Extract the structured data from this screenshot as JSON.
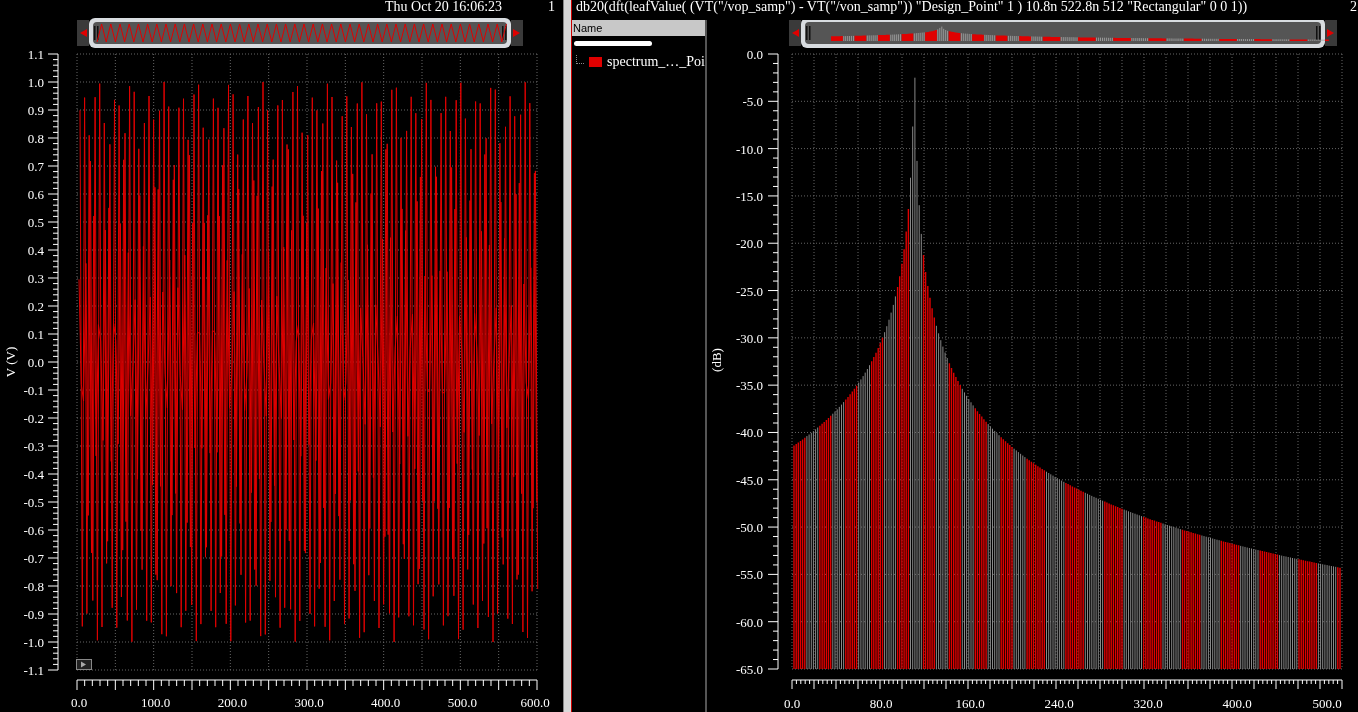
{
  "left_plot": {
    "timestamp": "Thu Oct 20 16:06:23",
    "corner_label": "1",
    "y_axis": {
      "label": "V (V)",
      "ticks": [
        "1.1",
        "1.0",
        "0.9",
        "0.8",
        "0.7",
        "0.6",
        "0.5",
        "0.4",
        "0.3",
        "0.2",
        "0.1",
        "0.0",
        "-0.1",
        "-0.2",
        "-0.3",
        "-0.4",
        "-0.5",
        "-0.6",
        "-0.7",
        "-0.8",
        "-0.9",
        "-1.0",
        "-1.1"
      ]
    },
    "x_axis": {
      "ticks": [
        "0.0",
        "100.0",
        "200.0",
        "300.0",
        "400.0",
        "500.0",
        "600.0"
      ]
    }
  },
  "right_section": {
    "title": "db20(dft(leafValue( (VT(\"/vop_samp\") - VT(\"/von_samp\")) \"Design_Point\" 1 )  10.8n 522.8n 512 \"Rectangular\" 0 0 1))",
    "legend": {
      "header": "Name",
      "items": [
        {
          "label": "spectrum_…_Poi"
        }
      ]
    },
    "plot": {
      "corner_label": "2",
      "y_axis": {
        "label": "(dB)",
        "ticks": [
          "0.0",
          "-5.0",
          "-10.0",
          "-15.0",
          "-20.0",
          "-25.0",
          "-30.0",
          "-35.0",
          "-40.0",
          "-45.0",
          "-50.0",
          "-55.0",
          "-60.0",
          "-65.0"
        ]
      },
      "x_axis": {
        "ticks": [
          "0.0",
          "80.0",
          "160.0",
          "240.0",
          "320.0",
          "400.0",
          "500.0"
        ]
      }
    }
  }
}
